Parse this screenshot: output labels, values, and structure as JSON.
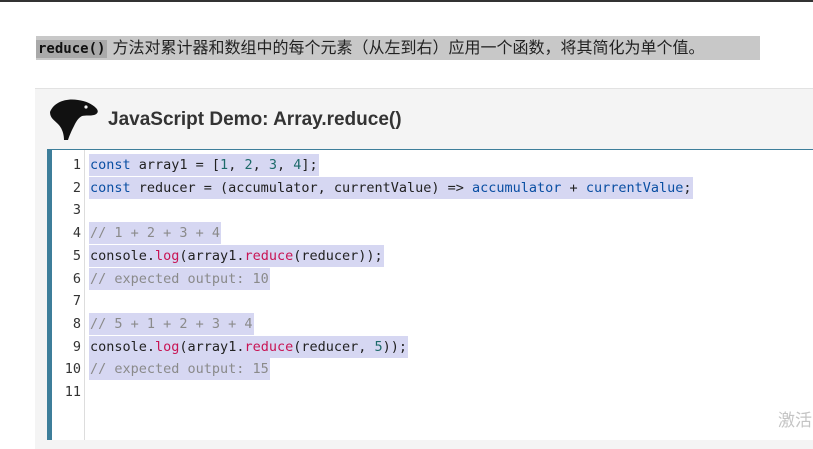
{
  "description": {
    "code": "reduce()",
    "text": "方法对累计器和数组中的每个元素（从左到右）应用一个函数，将其简化为单个值。"
  },
  "demo": {
    "logo_icon": "dinosaur-logo-icon",
    "title": "JavaScript Demo: Array.reduce()"
  },
  "code_lines": [
    {
      "n": "1",
      "parts": [
        [
          "kw",
          "const"
        ],
        [
          "",
          "  array1 = ["
        ],
        [
          "num",
          "1"
        ],
        [
          "",
          ", "
        ],
        [
          "num",
          "2"
        ],
        [
          "",
          ", "
        ],
        [
          "num",
          "3"
        ],
        [
          "",
          ", "
        ],
        [
          "num",
          "4"
        ],
        [
          "",
          "];"
        ]
      ]
    },
    {
      "n": "2",
      "parts": [
        [
          "kw",
          "const"
        ],
        [
          "",
          " reducer = (accumulator, currentValue) => "
        ],
        [
          "kw",
          "accumulator"
        ],
        [
          "",
          " + "
        ],
        [
          "kw",
          "currentValue"
        ],
        [
          "",
          ";"
        ]
      ]
    },
    {
      "n": "3",
      "parts": []
    },
    {
      "n": "4",
      "parts": [
        [
          "cm",
          "// 1 + 2 + 3 + 4"
        ]
      ]
    },
    {
      "n": "5",
      "parts": [
        [
          "",
          "console."
        ],
        [
          "fn",
          "log"
        ],
        [
          "",
          "(array1."
        ],
        [
          "fn",
          "reduce"
        ],
        [
          "",
          "(reducer));"
        ]
      ]
    },
    {
      "n": "6",
      "parts": [
        [
          "cm",
          "// expected output: 10"
        ]
      ]
    },
    {
      "n": "7",
      "parts": []
    },
    {
      "n": "8",
      "parts": [
        [
          "cm",
          "// 5 + 1 + 2 + 3 + 4"
        ]
      ]
    },
    {
      "n": "9",
      "parts": [
        [
          "",
          "console."
        ],
        [
          "fn",
          "log"
        ],
        [
          "",
          "(array1."
        ],
        [
          "fn",
          "reduce"
        ],
        [
          "",
          "(reducer, "
        ],
        [
          "num",
          "5"
        ],
        [
          "",
          "));"
        ]
      ]
    },
    {
      "n": "10",
      "parts": [
        [
          "cm",
          "// expected output: 15"
        ]
      ]
    },
    {
      "n": "11",
      "parts": []
    }
  ],
  "watermark": "激活"
}
